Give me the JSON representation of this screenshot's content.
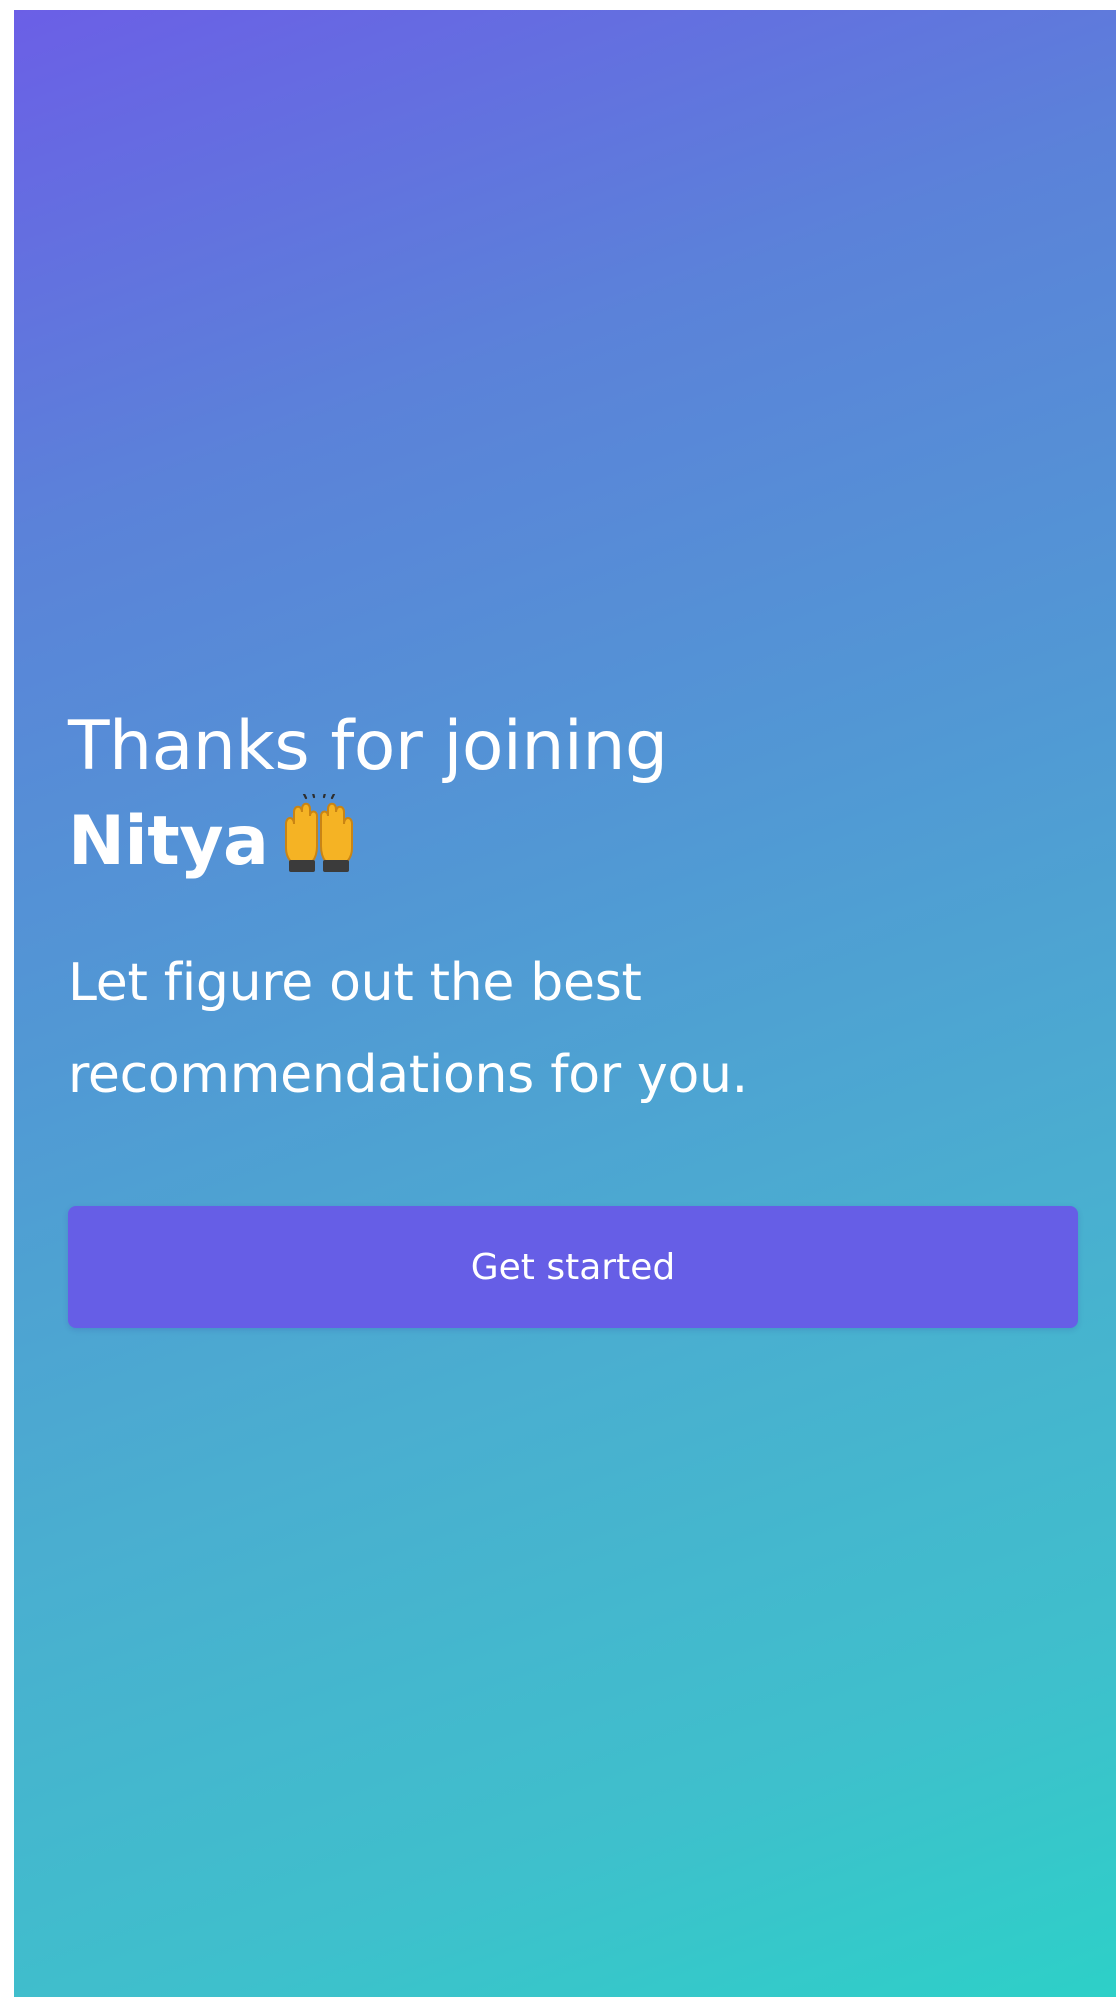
{
  "theme": {
    "accent": "#665ee6",
    "gradient_start": "#6b5fe6",
    "gradient_end": "#2dd0c8",
    "text": "#ffffff"
  },
  "welcome": {
    "title_line1": "Thanks for joining",
    "brand": "Nitya",
    "emoji_icon": "raising-hands-emoji",
    "subtitle_line1": "Let figure out the best",
    "subtitle_line2": "recommendations for you.",
    "cta_label": "Get started"
  }
}
